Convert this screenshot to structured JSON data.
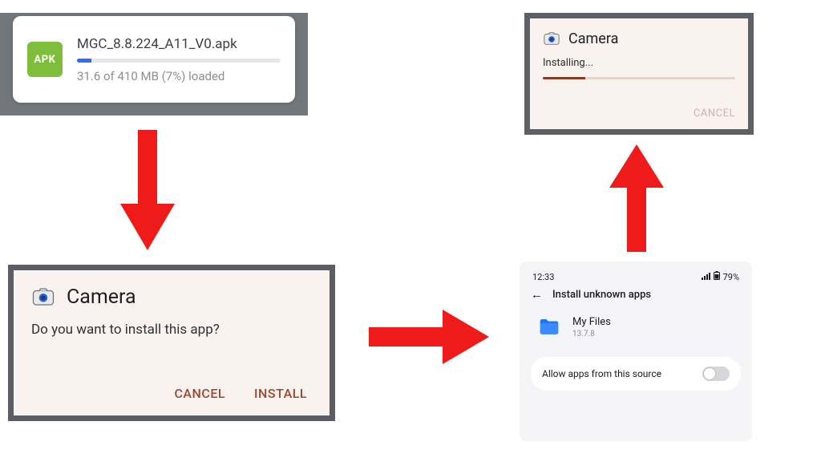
{
  "download": {
    "filename": "MGC_8.8.224_A11_V0.apk",
    "progress_percent": 7,
    "status_text": "31.6 of 410 MB (7%) loaded",
    "badge_text": "APK"
  },
  "install_prompt": {
    "app_name": "Camera",
    "message": "Do you want to install this app?",
    "cancel_label": "CANCEL",
    "install_label": "INSTALL"
  },
  "settings": {
    "time": "12:33",
    "battery_text": "79%",
    "page_title": "Install unknown apps",
    "app_name": "My Files",
    "app_version": "13.7.8",
    "allow_label": "Allow apps from this source",
    "allow_enabled": false
  },
  "installing": {
    "app_name": "Camera",
    "status_text": "Installing...",
    "progress_percent": 22,
    "cancel_label": "CANCEL"
  }
}
